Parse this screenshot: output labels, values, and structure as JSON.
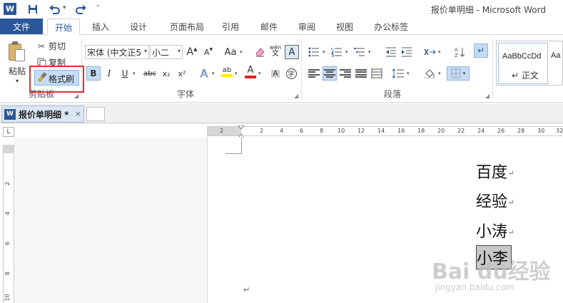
{
  "app": {
    "icon_letter": "W",
    "window_title": "报价单明细 - Microsoft Word",
    "quick_access": [
      "save-icon",
      "undo-icon",
      "redo-icon",
      "customize-icon"
    ]
  },
  "tabs": {
    "file": "文件",
    "items": [
      "开始",
      "插入",
      "设计",
      "页面布局",
      "引用",
      "邮件",
      "审阅",
      "视图",
      "办公标签"
    ],
    "active": "开始"
  },
  "clipboard": {
    "paste": "粘贴",
    "cut": "剪切",
    "copy": "复制",
    "format_painter": "格式刷",
    "label": "剪贴板"
  },
  "font": {
    "name": "宋体 (中文正5",
    "size": "小二",
    "grow": "A",
    "shrink": "A",
    "case": "Aa",
    "bold": "B",
    "italic": "I",
    "underline": "U",
    "strike": "abc",
    "subscript": "x₂",
    "superscript": "x²",
    "phonetic_top": "wén",
    "phonetic_bottom": "文",
    "char_border": "A",
    "text_effects": "A",
    "highlight": "ab",
    "font_color": "A",
    "enclose": "字",
    "label": "字体",
    "font_color_hex": "#e02020",
    "highlight_hex": "#ffee00"
  },
  "paragraph": {
    "label": "段落"
  },
  "styles": {
    "sample": "AaBbCcDd",
    "selected_name": "↵ 正文",
    "next_sample": "Aa"
  },
  "doc_tab": {
    "icon_letter": "W",
    "title": "报价单明细 *",
    "close": "×"
  },
  "ruler": {
    "corner": "L",
    "h_numbers": [
      "2",
      "2",
      "4",
      "6",
      "8",
      "10",
      "12",
      "14",
      "16",
      "18",
      "20",
      "22",
      "24",
      "26",
      "28",
      "30",
      "32"
    ],
    "v_numbers": [
      "2",
      "4",
      "6",
      "8",
      "10"
    ]
  },
  "document": {
    "lines": [
      "百度",
      "经验",
      "小涛",
      "小李"
    ],
    "para_mark": "↵",
    "selected_line_index": 3
  },
  "watermark": {
    "text": "Bai du经验",
    "sub": "jingyan.baidu.com"
  }
}
